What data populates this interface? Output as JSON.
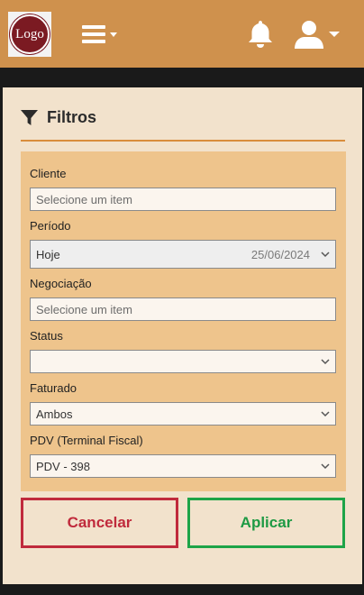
{
  "header": {
    "logo_text": "Logo",
    "menu_icon": "hamburger-menu-icon",
    "notification_icon": "bell-icon",
    "user_icon": "user-icon"
  },
  "panel": {
    "title": "Filtros",
    "title_icon": "filter-icon"
  },
  "filters": {
    "cliente": {
      "label": "Cliente",
      "placeholder": "Selecione um item"
    },
    "periodo": {
      "label": "Período",
      "value": "Hoje",
      "date": "25/06/2024"
    },
    "negociacao": {
      "label": "Negociação",
      "placeholder": "Selecione um item"
    },
    "status": {
      "label": "Status",
      "value": ""
    },
    "faturado": {
      "label": "Faturado",
      "value": "Ambos"
    },
    "pdv": {
      "label": "PDV (Terminal Fiscal)",
      "value": "PDV - 398"
    }
  },
  "actions": {
    "cancel_label": "Cancelar",
    "apply_label": "Aplicar"
  },
  "colors": {
    "topbar": "#cf914d",
    "panel_bg": "#f2e2cc",
    "form_bg": "#eec48c",
    "divider": "#d98d3c",
    "cancel": "#c02a3c",
    "apply": "#1ea448",
    "logo_bg": "#7b1a22"
  }
}
